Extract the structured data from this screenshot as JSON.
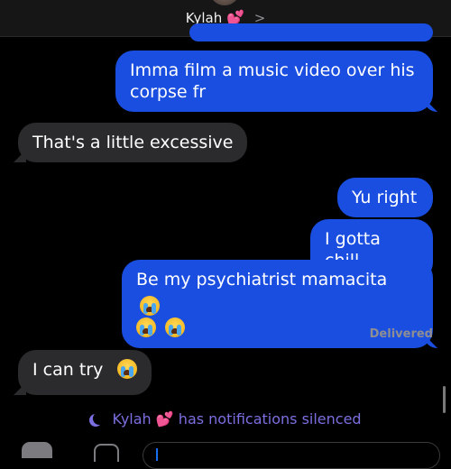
{
  "header": {
    "contact_name": "Kylah",
    "contact_emoji": "💕",
    "chevron": ">"
  },
  "messages": [
    {
      "sender": "me",
      "text": "Imma film a music video over his corpse fr"
    },
    {
      "sender": "them",
      "text": "That's a little excessive"
    },
    {
      "sender": "me",
      "text": "Yu right"
    },
    {
      "sender": "me",
      "text": "I gotta chill"
    },
    {
      "sender": "me",
      "text": "Be my psychiatrist mamacita",
      "emoji": "😭😭😭"
    },
    {
      "sender": "them",
      "text": "I can try",
      "emoji": "😭"
    }
  ],
  "delivered_label": "Delivered",
  "silenced_notice": {
    "name": "Kylah",
    "emoji": "💕",
    "text": "has notifications silenced"
  },
  "colors": {
    "sent_bubble": "#1a4ee0",
    "received_bubble": "#2b2b2d",
    "notice": "#7b6fe0"
  },
  "icons": [
    "moon-icon",
    "camera-icon",
    "apps-icon",
    "loudly-crying-face-icon"
  ]
}
